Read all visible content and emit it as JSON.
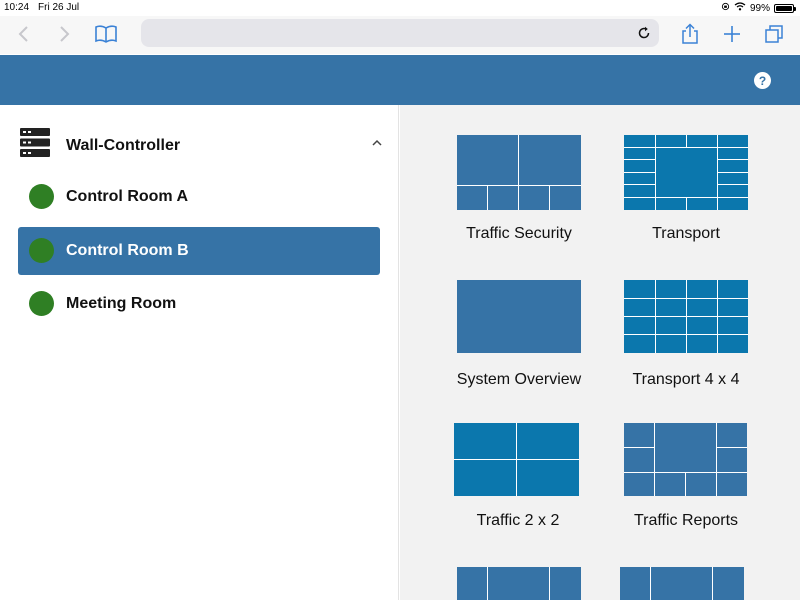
{
  "status_bar": {
    "time": "10:24",
    "date": "Fri 26 Jul",
    "battery": "99%",
    "battery_level": 0.99
  },
  "browser": {
    "back_icon": "chevron-left-icon",
    "forward_icon": "chevron-right-icon",
    "bookmarks_icon": "book-icon",
    "reload_icon": "reload-icon",
    "share_icon": "share-icon",
    "new_tab_icon": "plus-icon",
    "tabs_icon": "tabs-icon",
    "url": ""
  },
  "header": {
    "help_label": "?",
    "color": "#3673a6"
  },
  "sidebar": {
    "group": {
      "title": "Wall-Controller",
      "icon": "server-rack-icon",
      "expanded": true
    },
    "rooms": [
      {
        "label": "Control Room A",
        "status_color": "#2f7f24",
        "selected": false
      },
      {
        "label": "Control Room B",
        "status_color": "#2f7f24",
        "selected": true
      },
      {
        "label": "Meeting Room",
        "status_color": "#2f7f24",
        "selected": false
      }
    ]
  },
  "layouts": [
    {
      "label": "Traffic Security"
    },
    {
      "label": "Transport"
    },
    {
      "label": "System Overview"
    },
    {
      "label": "Transport 4 x 4"
    },
    {
      "label": "Traffic 2 x 2"
    },
    {
      "label": "Traffic Reports"
    },
    {
      "label": ""
    },
    {
      "label": ""
    }
  ],
  "colors": {
    "accent": "#3673a6",
    "accent_alt": "#0b77ad",
    "status_green": "#2f7f24"
  }
}
